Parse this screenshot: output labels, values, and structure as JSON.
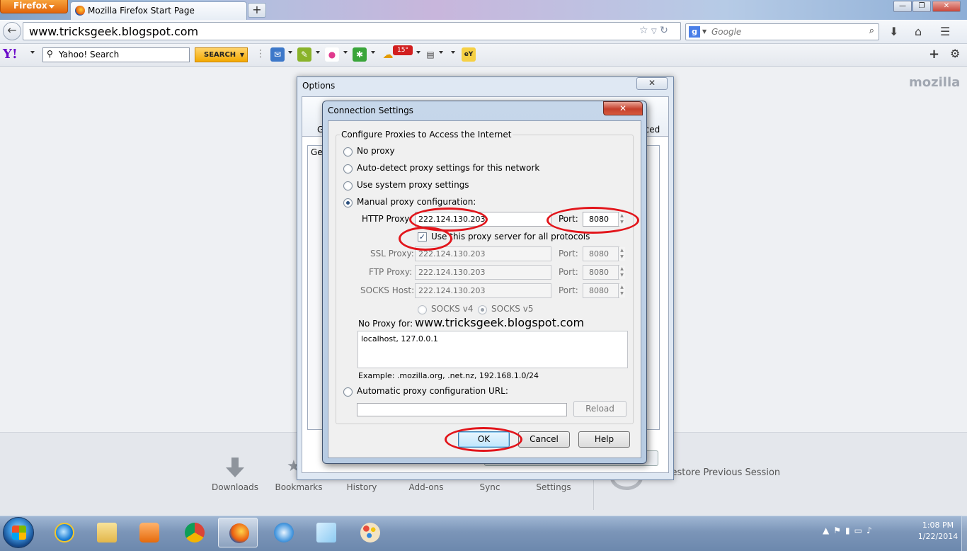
{
  "browser": {
    "menu_button": "Firefox",
    "tab_title": "Mozilla Firefox Start Page",
    "new_tab": "+",
    "url": "www.tricksgeek.blogspot.com",
    "search_engine": "Google",
    "search_placeholder": "Google"
  },
  "yahoo_toolbar": {
    "logo": "Y!",
    "search_value": "Yahoo! Search",
    "search_button": "SEARCH",
    "weather": "15°"
  },
  "start_page": {
    "brand": "mozilla",
    "launcher": [
      "Downloads",
      "Bookmarks",
      "History",
      "Add-ons",
      "Sync",
      "Settings"
    ],
    "restore_session": "Restore Previous Session"
  },
  "options_window": {
    "title": "Options",
    "tab_general_fragment": "Ge",
    "tab_advanced_fragment": "nced",
    "general_fragment": "Gen"
  },
  "connection_settings": {
    "title": "Connection Settings",
    "group_label": "Configure Proxies to Access the Internet",
    "options": {
      "no_proxy": "No proxy",
      "auto_detect": "Auto-detect proxy settings for this network",
      "system": "Use system proxy settings",
      "manual": "Manual proxy configuration:",
      "auto_url": "Automatic proxy configuration URL:"
    },
    "selected": "manual",
    "http": {
      "label": "HTTP Proxy:",
      "value": "222.124.130.203",
      "port_label": "Port:",
      "port": "8080"
    },
    "use_for_all": {
      "label": "Use this proxy server for all protocols",
      "checked": true
    },
    "ssl": {
      "label": "SSL Proxy:",
      "value": "222.124.130.203",
      "port_label": "Port:",
      "port": "8080"
    },
    "ftp": {
      "label": "FTP Proxy:",
      "value": "222.124.130.203",
      "port_label": "Port:",
      "port": "8080"
    },
    "socks": {
      "label": "SOCKS Host:",
      "value": "222.124.130.203",
      "port_label": "Port:",
      "port": "8080"
    },
    "socks_v4": "SOCKS v4",
    "socks_v5": "SOCKS v5",
    "no_proxy_label": "No Proxy for:",
    "no_proxy_value": "localhost, 127.0.0.1",
    "example": "Example: .mozilla.org, .net.nz, 192.168.1.0/24",
    "auto_url_value": "",
    "reload": "Reload",
    "ok": "OK",
    "cancel": "Cancel",
    "help": "Help"
  },
  "watermark": "www.tricksgeek.blogspot.com",
  "taskbar": {
    "time": "1:08 PM",
    "date": "1/22/2014"
  },
  "colors": {
    "annotation": "#e2151b",
    "firefox_orange": "#e2650b",
    "yahoo_purple": "#6b0ac9"
  }
}
